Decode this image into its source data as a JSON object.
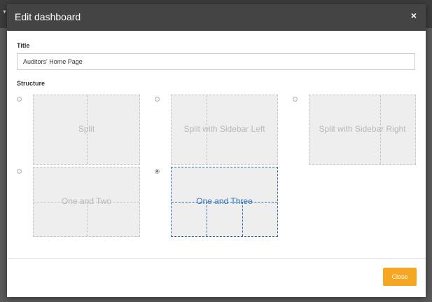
{
  "modal": {
    "title": "Edit dashboard",
    "close_icon": "×"
  },
  "form": {
    "title_label": "Title",
    "title_value": "Auditors' Home Page",
    "structure_label": "Structure"
  },
  "structures": [
    {
      "label": "Split",
      "selected": false
    },
    {
      "label": "Split with Sidebar Left",
      "selected": false
    },
    {
      "label": "Split with Sidebar Right",
      "selected": false
    },
    {
      "label": "One and Two",
      "selected": false
    },
    {
      "label": "One and Three",
      "selected": true
    }
  ],
  "footer": {
    "close_label": "Close"
  },
  "colors": {
    "header_bg": "#444444",
    "accent": "#f5a623",
    "selected_border": "#2a6fb5"
  }
}
